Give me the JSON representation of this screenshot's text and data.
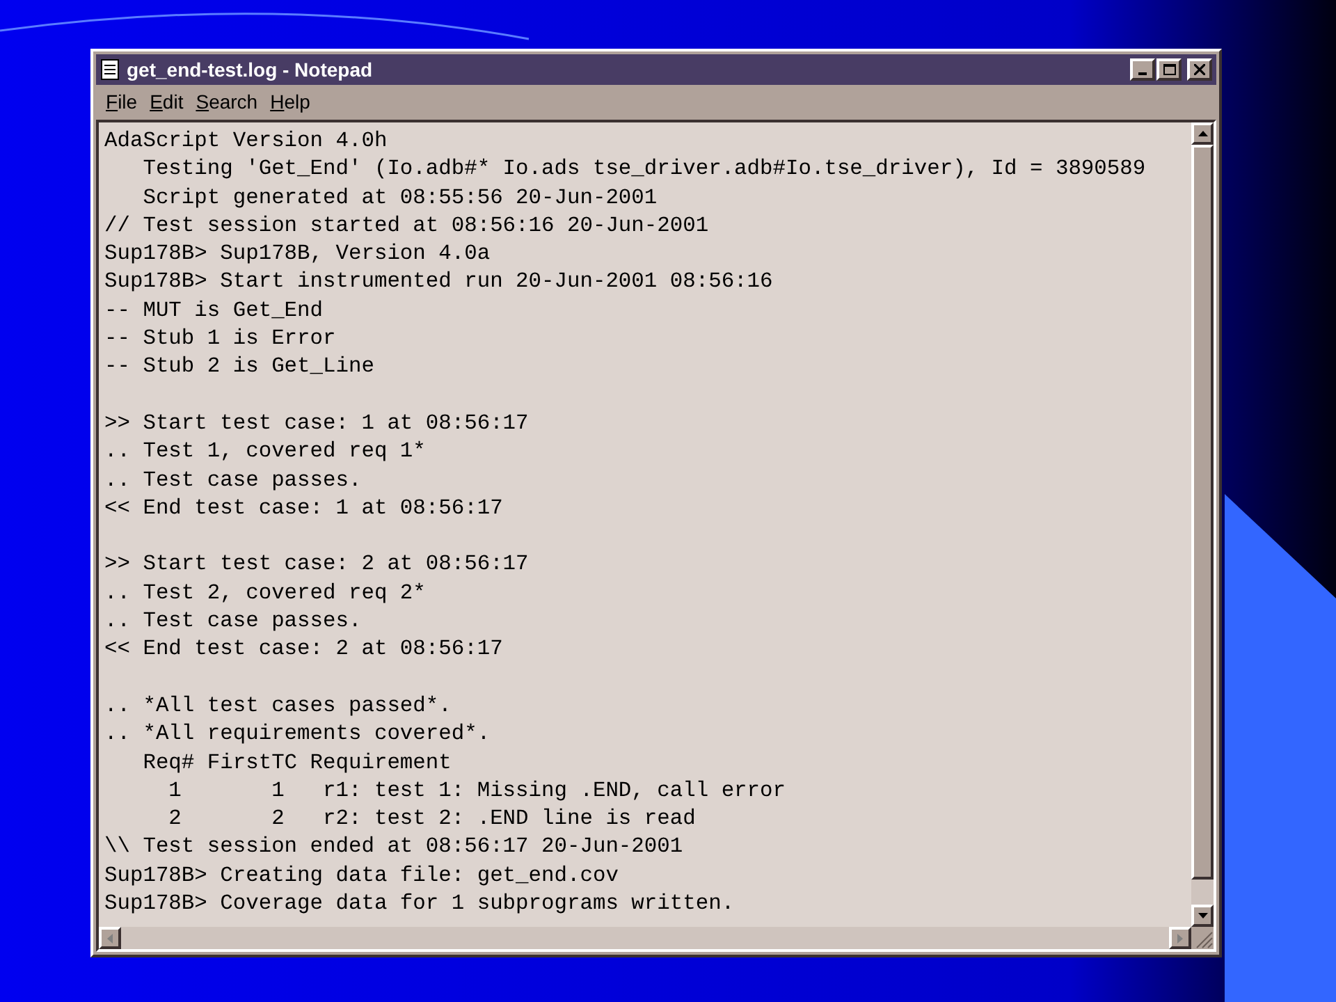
{
  "window": {
    "title": "get_end-test.log - Notepad"
  },
  "menu": [
    "File",
    "Edit",
    "Search",
    "Help"
  ],
  "blocks": [
    [
      "AdaScript Version 4.0h",
      "   Testing 'Get_End' (Io.adb#* Io.ads tse_driver.adb#Io.tse_driver), Id = 3890589",
      "   Script generated at 08:55:56 20-Jun-2001",
      "// Test session started at 08:56:16 20-Jun-2001",
      "Sup178B> Sup178B, Version 4.0a",
      "Sup178B> Start instrumented run 20-Jun-2001 08:56:16",
      "-- MUT is Get_End",
      "-- Stub 1 is Error",
      "-- Stub 2 is Get_Line"
    ],
    [
      ">> Start test case: 1 at 08:56:17",
      ".. Test 1, covered req 1*",
      ".. Test case passes.",
      "<< End test case: 1 at 08:56:17"
    ],
    [
      ">> Start test case: 2 at 08:56:17",
      ".. Test 2, covered req 2*",
      ".. Test case passes.",
      "<< End test case: 2 at 08:56:17"
    ],
    [
      ".. *All test cases passed*.",
      ".. *All requirements covered*.",
      "   Req# FirstTC Requirement",
      "     1       1   r1: test 1: Missing .END, call error",
      "     2       2   r2: test 2: .END line is read",
      "\\\\ Test session ended at 08:56:17 20-Jun-2001",
      "Sup178B> Creating data file: get_end.cov",
      "Sup178B> Coverage data for 1 subprograms written."
    ]
  ]
}
